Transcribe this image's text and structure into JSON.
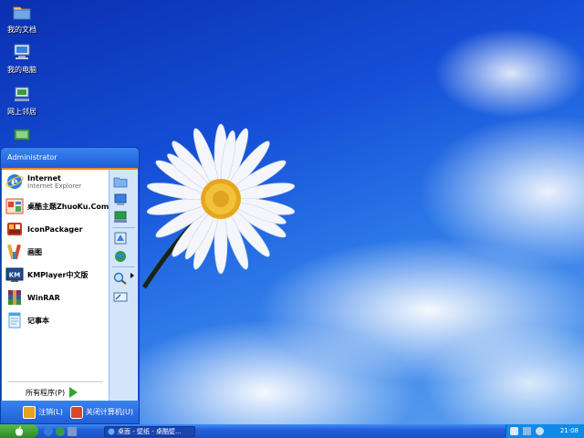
{
  "desktop": {
    "icons": [
      {
        "label": "我的文档",
        "icon": "folder-icon"
      },
      {
        "label": "我的电脑",
        "icon": "computer-icon"
      },
      {
        "label": "网上邻居",
        "icon": "network-icon"
      },
      {
        "label": "",
        "icon": "monitor-icon"
      }
    ]
  },
  "start_menu": {
    "user": "Administrator",
    "programs": [
      {
        "name": "Internet",
        "sub": "Internet Explorer",
        "icon": "internet-explorer-icon",
        "color": "#2a7fd8"
      },
      {
        "name": "桌酷主题ZhuoKu.Com",
        "sub": "",
        "icon": "zhuoku-theme-icon",
        "color": "#d9472b"
      },
      {
        "name": "IconPackager",
        "sub": "",
        "icon": "iconpackager-icon",
        "color": "#c53a1f"
      },
      {
        "name": "画图",
        "sub": "",
        "icon": "paint-icon",
        "color": "#e2a93a"
      },
      {
        "name": "KMPlayer中文版",
        "sub": "",
        "icon": "kmplayer-icon",
        "color": "#234a8c"
      },
      {
        "name": "WinRAR",
        "sub": "",
        "icon": "winrar-icon",
        "color": "#8a2a5f"
      },
      {
        "name": "记事本",
        "sub": "",
        "icon": "notepad-icon",
        "color": "#4aa3e8"
      }
    ],
    "all_programs": "所有程序(P)",
    "right_items": [
      {
        "icon": "my-documents-icon"
      },
      {
        "icon": "my-computer-icon"
      },
      {
        "icon": "network-places-icon"
      },
      {
        "icon": "control-panel-icon"
      },
      {
        "icon": "connect-to-icon"
      },
      {
        "icon": "search-icon"
      },
      {
        "icon": "run-icon"
      }
    ],
    "logoff_label": "注销(L)",
    "shutdown_label": "关闭计算机(U)"
  },
  "taskbar": {
    "task_label": "桌面 - 壁纸 - 桌酷壁...",
    "clock": "21:08"
  },
  "colors": {
    "start_green": "#2d8a23",
    "menu_blue": "#1e5fd6",
    "accent_orange": "#f08a24"
  }
}
